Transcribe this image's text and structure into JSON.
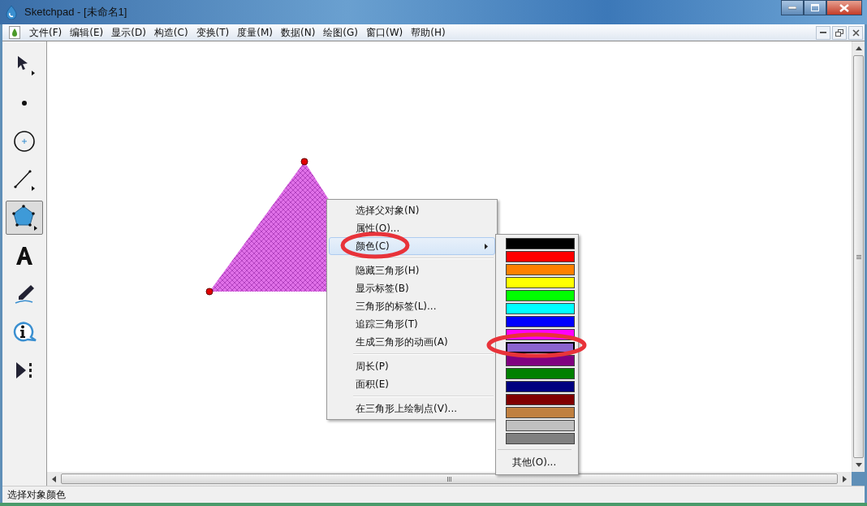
{
  "window": {
    "title": "Sketchpad  - [未命名1]"
  },
  "menu_bar": [
    {
      "label": "文件(F)"
    },
    {
      "label": "编辑(E)"
    },
    {
      "label": "显示(D)"
    },
    {
      "label": "构造(C)"
    },
    {
      "label": "变换(T)"
    },
    {
      "label": "度量(M)"
    },
    {
      "label": "数据(N)"
    },
    {
      "label": "绘图(G)"
    },
    {
      "label": "窗口(W)"
    },
    {
      "label": "帮助(H)"
    }
  ],
  "toolbox": [
    {
      "kind": "arrow",
      "selected": false
    },
    {
      "kind": "point",
      "selected": false
    },
    {
      "kind": "compass",
      "selected": false
    },
    {
      "kind": "line",
      "selected": false
    },
    {
      "kind": "polygon",
      "selected": true
    },
    {
      "kind": "text",
      "selected": false
    },
    {
      "kind": "marker",
      "selected": false
    },
    {
      "kind": "info",
      "selected": false
    },
    {
      "kind": "custom",
      "selected": false
    }
  ],
  "context_menu": {
    "groups": [
      [
        {
          "label": "选择父对象(N)",
          "selected": false,
          "has_submenu": false
        },
        {
          "label": "属性(O)...",
          "selected": false,
          "has_submenu": false
        },
        {
          "label": "颜色(C)",
          "selected": true,
          "has_submenu": true
        }
      ],
      [
        {
          "label": "隐藏三角形(H)",
          "selected": false,
          "has_submenu": false
        },
        {
          "label": "显示标签(B)",
          "selected": false,
          "has_submenu": false
        },
        {
          "label": "三角形的标签(L)...",
          "selected": false,
          "has_submenu": false
        },
        {
          "label": "追踪三角形(T)",
          "selected": false,
          "has_submenu": false
        },
        {
          "label": "生成三角形的动画(A)",
          "selected": false,
          "has_submenu": false
        }
      ],
      [
        {
          "label": "周长(P)",
          "selected": false,
          "has_submenu": false
        },
        {
          "label": "面积(E)",
          "selected": false,
          "has_submenu": false
        }
      ],
      [
        {
          "label": "在三角形上绘制点(V)...",
          "selected": false,
          "has_submenu": false
        }
      ]
    ]
  },
  "color_submenu": {
    "swatches": [
      {
        "color": "#000000",
        "selected": false
      },
      {
        "color": "#ff0000",
        "selected": false
      },
      {
        "color": "#ff8000",
        "selected": false
      },
      {
        "color": "#ffff00",
        "selected": false
      },
      {
        "color": "#00ff00",
        "selected": false
      },
      {
        "color": "#00ffff",
        "selected": false
      },
      {
        "color": "#0000ff",
        "selected": false
      },
      {
        "color": "#ff00ff",
        "selected": false
      },
      {
        "color": "#8c64d0",
        "selected": true
      },
      {
        "color": "#800080",
        "selected": false
      },
      {
        "color": "#008000",
        "selected": false
      },
      {
        "color": "#000080",
        "selected": false
      },
      {
        "color": "#800000",
        "selected": false
      },
      {
        "color": "#c08040",
        "selected": false
      },
      {
        "color": "#c0c0c0",
        "selected": false
      },
      {
        "color": "#808080",
        "selected": false
      }
    ],
    "other_label": "其他(O)..."
  },
  "status_bar": {
    "text": "选择对象颜色"
  }
}
